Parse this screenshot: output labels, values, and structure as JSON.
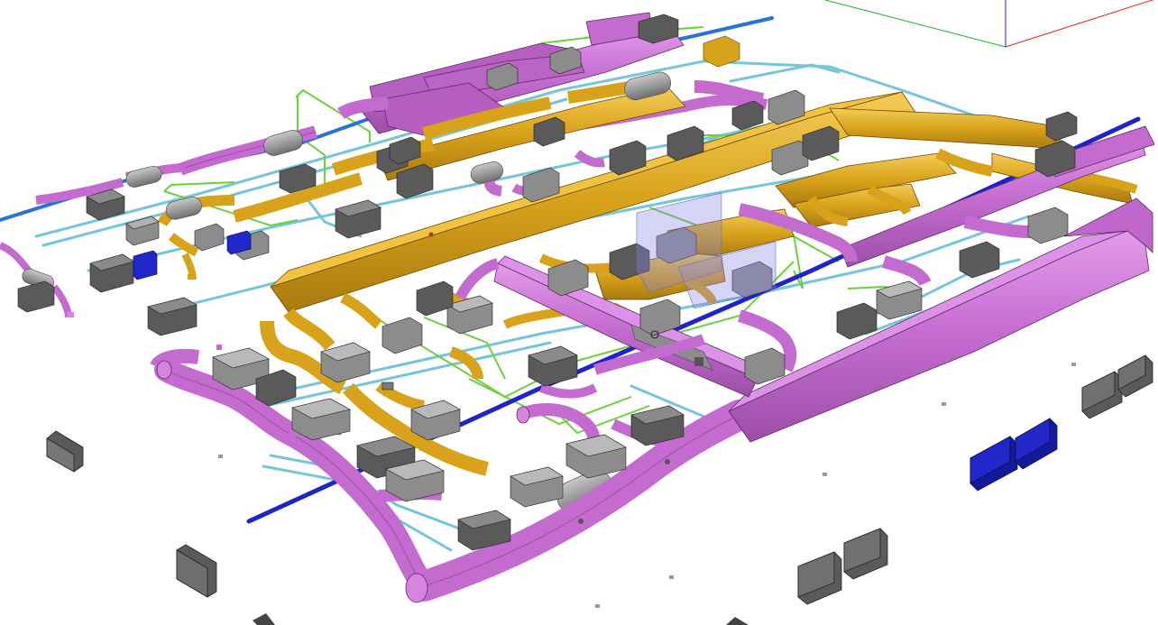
{
  "scene": {
    "type": "3d-model-viewport",
    "description_visible_text": "",
    "colors": {
      "supply_duct": "#c46bd0",
      "supply_duct_dark": "#9d4ea8",
      "return_duct": "#d8a21a",
      "return_duct_dark": "#a87a10",
      "air_handler": "#8c8c8c",
      "air_handler_dark": "#5e5e5e",
      "vav_box": "#6d6d6d",
      "pipe_cyan": "#74c6d8",
      "pipe_green": "#6bd13c",
      "pipe_blue": "#1e24c8",
      "pipe_blue_light": "#2a73d6",
      "blue_unit": "#2227c9",
      "sheath": "#a3a3a3",
      "axis_red": "#e02020",
      "axis_green": "#20c020",
      "axis_blue": "#2020e0",
      "grey_box": "#9b9b9b"
    },
    "icons": [
      "axis-gizmo-icon"
    ]
  }
}
